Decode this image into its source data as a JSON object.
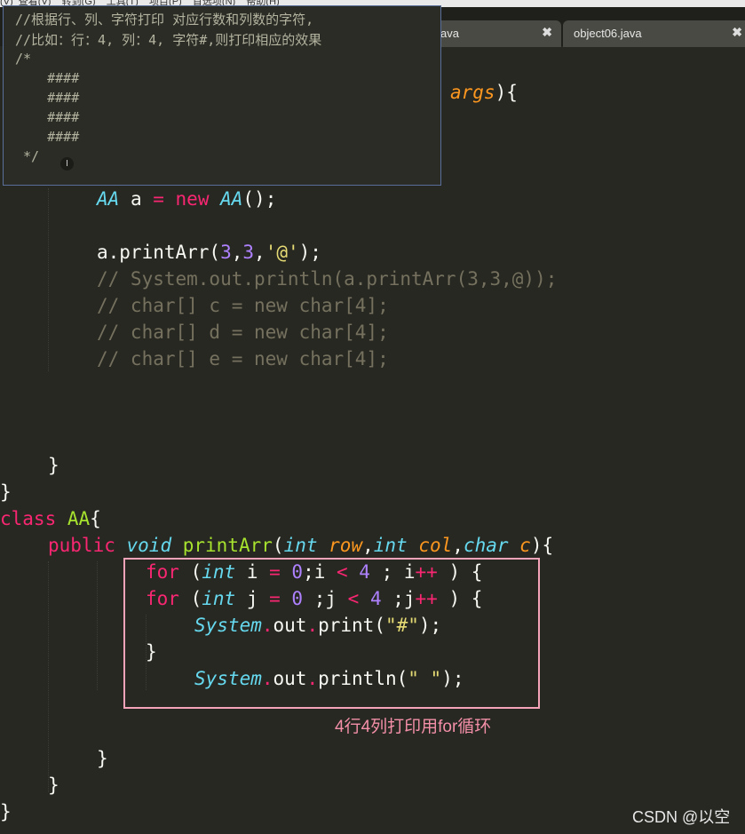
{
  "menubar": {
    "text": "(V)  查看(V)    转到(G)    工具(T)    项目(P)    首选项(N)    帮助(H)"
  },
  "tabs": [
    {
      "label": "ava",
      "close": "✖"
    },
    {
      "label": "object06.java",
      "close": "✖"
    }
  ],
  "code": {
    "l1": {
      "param": "args",
      "rest": "){"
    },
    "l2": {
      "type": "AA",
      "var": " a ",
      "op": "=",
      "kw": " new ",
      "type2": "AA",
      "rest": "();"
    },
    "l3": {
      "obj": "a.printArr(",
      "n1": "3",
      "c1": ",",
      "n2": "3",
      "c2": ",",
      "s": "'@'",
      "rest": ");"
    },
    "l4": "// System.out.println(a.printArr(3,3,@));",
    "l5": "// char[] c = new char[4];",
    "l6": "// char[] d = new char[4];",
    "l7": "// char[] e = new char[4];",
    "close1": "}",
    "close2": "}",
    "cls": {
      "kw": "class",
      "name": " AA",
      "rest": "{"
    },
    "meth": {
      "kw": "public",
      "ty": "void",
      "fn": "printArr",
      "p1t": "int",
      "p1": "row",
      "p2t": "int",
      "p2": "col",
      "p3t": "char",
      "p3": "c",
      "rest": "){"
    },
    "for1": {
      "kw": "for",
      "a": " (",
      "ty": "int",
      "b": " i ",
      "op": "=",
      "n0": " 0",
      "c": ";i ",
      "lt": "<",
      "n4": " 4",
      "d": " ; i",
      "inc": "++",
      "e": " ) {"
    },
    "for2": {
      "kw": "for",
      "a": " (",
      "ty": "int",
      "b": " j ",
      "op": "=",
      "n0": " 0",
      "c": " ;j ",
      "lt": "<",
      "n4": " 4",
      "d": " ;j",
      "inc": "++",
      "e": " ) {"
    },
    "print1": {
      "sys": "System",
      "dot": ".",
      "out": "out",
      "dot2": ".",
      "m": "print(",
      "s": "\"#\"",
      "rest": ");"
    },
    "brace": "}",
    "print2": {
      "sys": "System",
      "dot": ".",
      "out": "out",
      "dot2": ".",
      "m": "println(",
      "s": "\" \"",
      "rest": ");"
    },
    "close3": "}",
    "close4": "}",
    "close5": "}"
  },
  "annotation": {
    "note": "4行4列打印用for循环"
  },
  "tooltip": {
    "lines": [
      "//根据行、列、字符打印 对应行数和列数的字符,",
      "//比如：行：4, 列：4, 字符#,则打印相应的效果",
      "/*",
      "    ####",
      "    ####",
      "    ####",
      "    ####",
      " */"
    ],
    "cursor": "I"
  },
  "watermark": "CSDN @以空"
}
